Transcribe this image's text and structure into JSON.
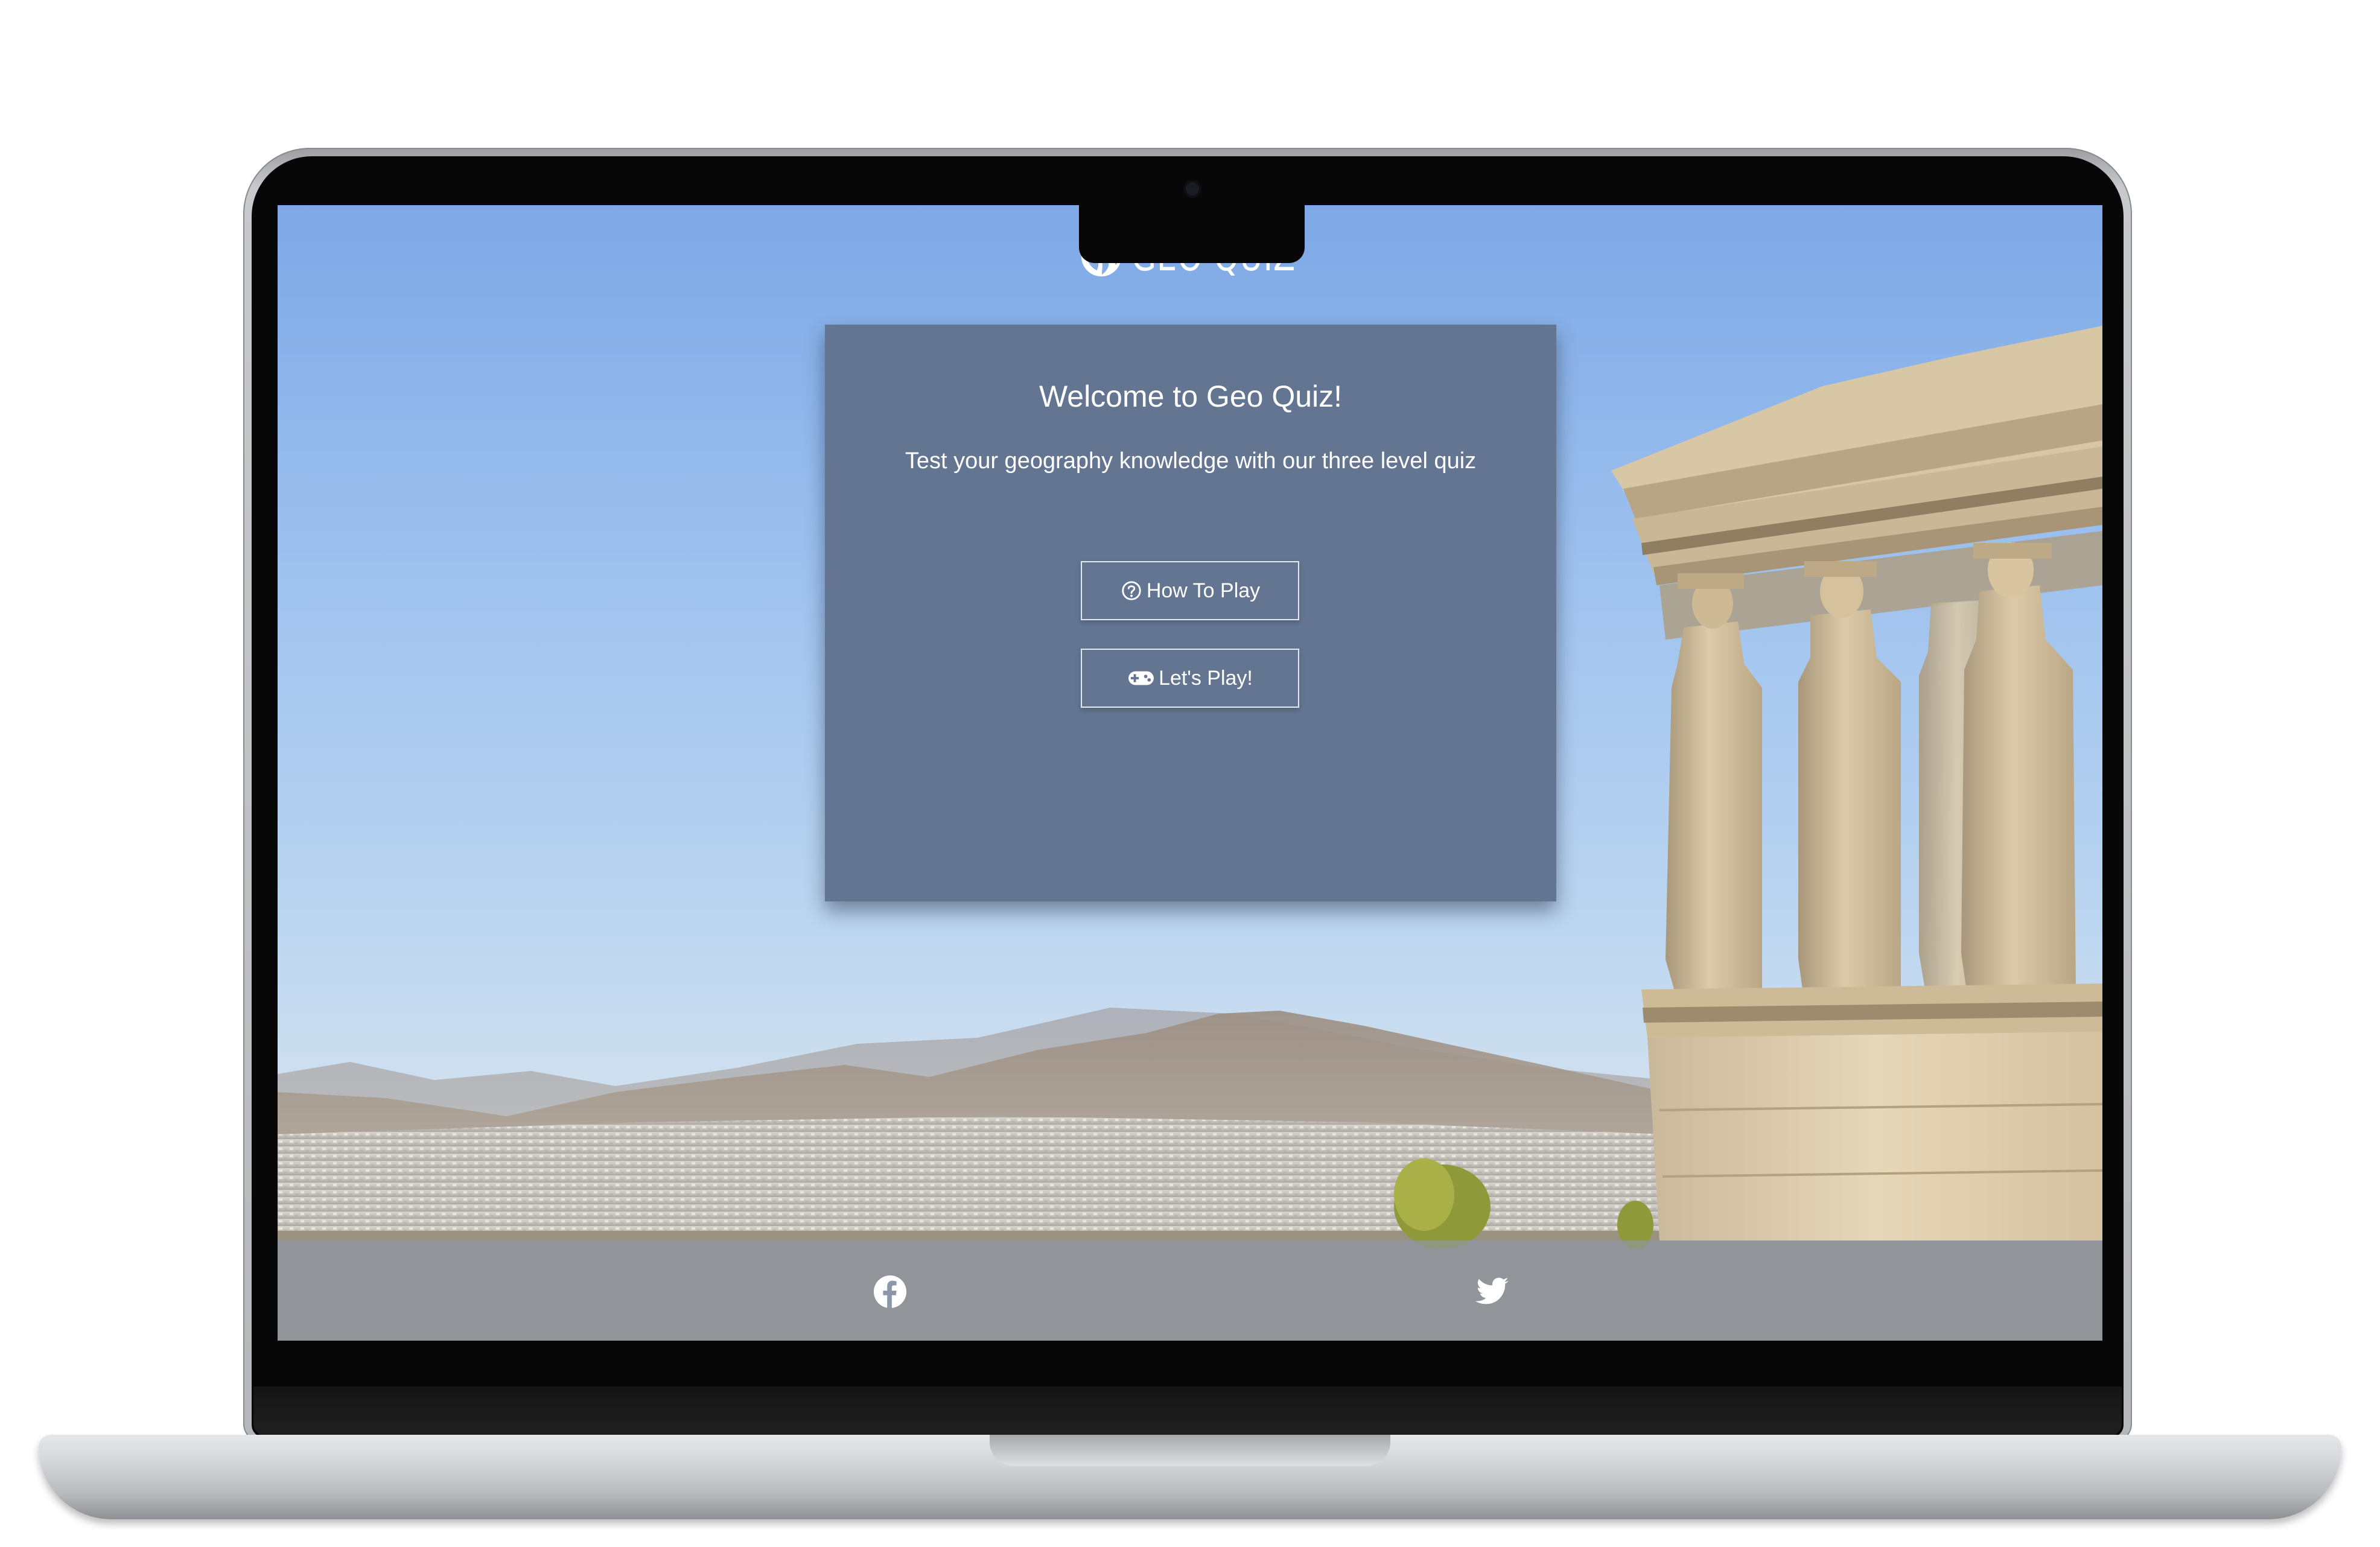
{
  "header": {
    "logo_icon": "globe-icon",
    "title": "GEO QUIZ"
  },
  "card": {
    "title": "Welcome to Geo Quiz!",
    "subtitle": "Test your geography knowledge with our three level quiz",
    "buttons": [
      {
        "label": "How To Play",
        "icon": "question-circle-icon"
      },
      {
        "label": "Let's Play!",
        "icon": "gamepad-icon"
      }
    ]
  },
  "footer": {
    "links": [
      {
        "icon": "facebook-icon"
      },
      {
        "icon": "twitter-icon"
      }
    ]
  },
  "colors": {
    "card_background": "#637591",
    "sky": "#86aee6",
    "footer_overlay": "#8c98aa"
  }
}
